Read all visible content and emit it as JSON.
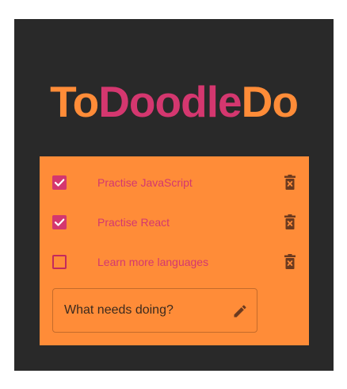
{
  "app": {
    "title_parts": {
      "first": "To",
      "middle": "Doodle",
      "last": "Do"
    }
  },
  "todos": [
    {
      "label": "Practise JavaScript",
      "checked": true
    },
    {
      "label": "Practise React",
      "checked": true
    },
    {
      "label": "Learn more languages",
      "checked": false
    }
  ],
  "new_todo": {
    "placeholder": "What needs doing?",
    "value": ""
  },
  "icons": {
    "checkbox_checked": "check-icon",
    "delete": "trash-icon",
    "edit": "pencil-icon"
  },
  "colors": {
    "background": "#292929",
    "card": "#ff8c38",
    "accent_pink": "#d4376f",
    "accent_orange": "#ff8c38",
    "icon_dark": "#6b3a1f"
  }
}
